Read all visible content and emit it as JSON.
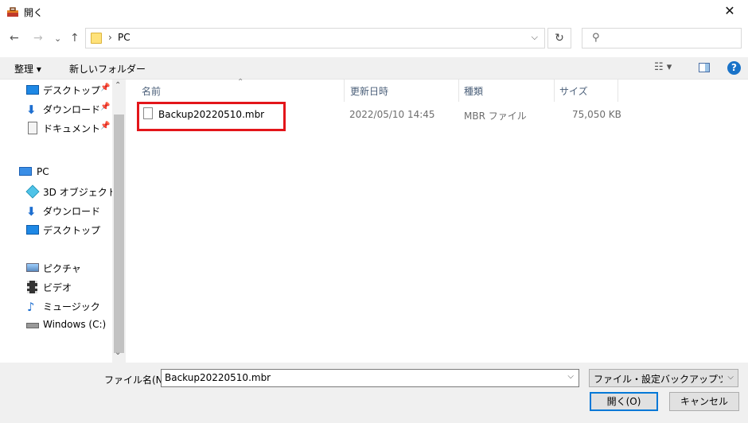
{
  "window": {
    "title": "開く",
    "close_glyph": "✕"
  },
  "nav": {
    "back_glyph": "←",
    "forward_glyph": "→",
    "recent_glyph": "⌄",
    "up_glyph": "↑",
    "address_sep": "›",
    "address_location": "PC",
    "address_dropdown_glyph": "⌵",
    "refresh_glyph": "↻",
    "search_glyph": "⚲"
  },
  "toolbar": {
    "organize_label": "整理 ▾",
    "new_folder_label": "新しいフォルダー",
    "view_label": "☷ ▾",
    "help_label": "?"
  },
  "sidebar": {
    "pin_glyph": "📌",
    "quick_access": [
      {
        "label": "デスクトップ",
        "icon": "desktop-icon"
      },
      {
        "label": "ダウンロード",
        "icon": "download-icon"
      },
      {
        "label": "ドキュメント",
        "icon": "document-icon"
      }
    ],
    "pc_label": "PC",
    "pc_items": [
      {
        "label": "3D オブジェクト",
        "icon": "3d-objects-icon"
      },
      {
        "label": "ダウンロード",
        "icon": "download-icon"
      },
      {
        "label": "デスクトップ",
        "icon": "desktop-icon"
      },
      {
        "label": "ピクチャ",
        "icon": "pictures-icon"
      },
      {
        "label": "ビデオ",
        "icon": "video-icon"
      },
      {
        "label": "ミュージック",
        "icon": "music-icon"
      },
      {
        "label": "Windows (C:)",
        "icon": "drive-icon"
      }
    ],
    "scroll_up_glyph": "⌃",
    "scroll_down_glyph": "⌄"
  },
  "file_list": {
    "columns": {
      "name": "名前",
      "modified": "更新日時",
      "type": "種類",
      "size": "サイズ"
    },
    "sort_glyph": "⌃",
    "rows": [
      {
        "name": "Backup20220510.mbr",
        "modified": "2022/05/10 14:45",
        "type": "MBR ファイル",
        "size": "75,050 KB"
      }
    ]
  },
  "footer": {
    "filename_label": "ファイル名(N):",
    "filename_value": "Backup20220510.mbr",
    "dropdown_glyph": "⌵",
    "filetype_value": "ファイル・設定バックアップツール バッ",
    "open_label": "開く(O)",
    "cancel_label": "キャンセル"
  },
  "colors": {
    "accent": "#0078d7",
    "highlight_border": "#e3151a",
    "help_blue": "#1a73c8"
  }
}
